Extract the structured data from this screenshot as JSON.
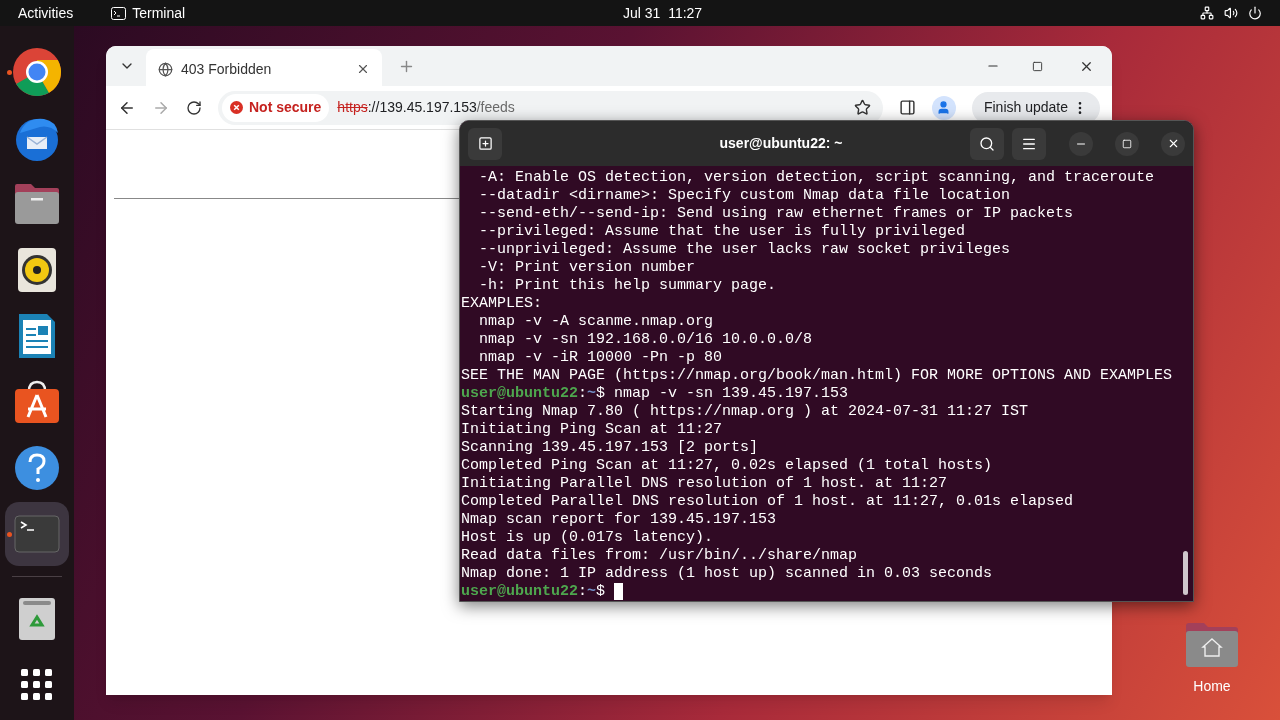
{
  "top_bar": {
    "activities": "Activities",
    "app": "Terminal",
    "clock": "Jul 31  11:27"
  },
  "dock": {
    "items": [
      {
        "kind": "browser",
        "running": true,
        "selected": false
      },
      {
        "kind": "mail",
        "running": false,
        "selected": false
      },
      {
        "kind": "folder",
        "running": false,
        "selected": false
      },
      {
        "kind": "speaker",
        "running": false,
        "selected": false
      },
      {
        "kind": "document",
        "running": false,
        "selected": false
      },
      {
        "kind": "store",
        "running": false,
        "selected": false
      },
      {
        "kind": "help",
        "running": false,
        "selected": false
      },
      {
        "kind": "terminal",
        "running": true,
        "selected": true
      },
      {
        "kind": "trash",
        "running": false,
        "selected": false
      }
    ]
  },
  "browser": {
    "tab": {
      "title": "403 Forbidden"
    },
    "security": "Not secure",
    "url": {
      "scheme": "https",
      "host": "://139.45.197.153",
      "path": "/feeds"
    },
    "update_button": "Finish update"
  },
  "terminal": {
    "title": "user@ubuntu22: ~",
    "lines": [
      {
        "kind": "output",
        "text": "  -A: Enable OS detection, version detection, script scanning, and traceroute"
      },
      {
        "kind": "output",
        "text": "  --datadir <dirname>: Specify custom Nmap data file location"
      },
      {
        "kind": "output",
        "text": "  --send-eth/--send-ip: Send using raw ethernet frames or IP packets"
      },
      {
        "kind": "output",
        "text": "  --privileged: Assume that the user is fully privileged"
      },
      {
        "kind": "output",
        "text": "  --unprivileged: Assume the user lacks raw socket privileges"
      },
      {
        "kind": "output",
        "text": "  -V: Print version number"
      },
      {
        "kind": "output",
        "text": "  -h: Print this help summary page."
      },
      {
        "kind": "output",
        "text": "EXAMPLES:"
      },
      {
        "kind": "output",
        "text": "  nmap -v -A scanme.nmap.org"
      },
      {
        "kind": "output",
        "text": "  nmap -v -sn 192.168.0.0/16 10.0.0.0/8"
      },
      {
        "kind": "output",
        "text": "  nmap -v -iR 10000 -Pn -p 80"
      },
      {
        "kind": "output",
        "text": "SEE THE MAN PAGE (https://nmap.org/book/man.html) FOR MORE OPTIONS AND EXAMPLES"
      },
      {
        "kind": "prompt",
        "user": "user@ubuntu22",
        "separator": ":",
        "path": "~",
        "symbol": "$",
        "command": " nmap -v -sn 139.45.197.153",
        "cursor": false
      },
      {
        "kind": "output",
        "text": "Starting Nmap 7.80 ( https://nmap.org ) at 2024-07-31 11:27 IST"
      },
      {
        "kind": "output",
        "text": "Initiating Ping Scan at 11:27"
      },
      {
        "kind": "output",
        "text": "Scanning 139.45.197.153 [2 ports]"
      },
      {
        "kind": "output",
        "text": "Completed Ping Scan at 11:27, 0.02s elapsed (1 total hosts)"
      },
      {
        "kind": "output",
        "text": "Initiating Parallel DNS resolution of 1 host. at 11:27"
      },
      {
        "kind": "output",
        "text": "Completed Parallel DNS resolution of 1 host. at 11:27, 0.01s elapsed"
      },
      {
        "kind": "output",
        "text": "Nmap scan report for 139.45.197.153"
      },
      {
        "kind": "output",
        "text": "Host is up (0.017s latency)."
      },
      {
        "kind": "output",
        "text": "Read data files from: /usr/bin/../share/nmap"
      },
      {
        "kind": "output",
        "text": "Nmap done: 1 IP address (1 host up) scanned in 0.03 seconds"
      },
      {
        "kind": "prompt",
        "user": "user@ubuntu22",
        "separator": ":",
        "path": "~",
        "symbol": "$",
        "cursor": true
      }
    ]
  },
  "desktop_icons": [
    {
      "label": "Home"
    }
  ]
}
